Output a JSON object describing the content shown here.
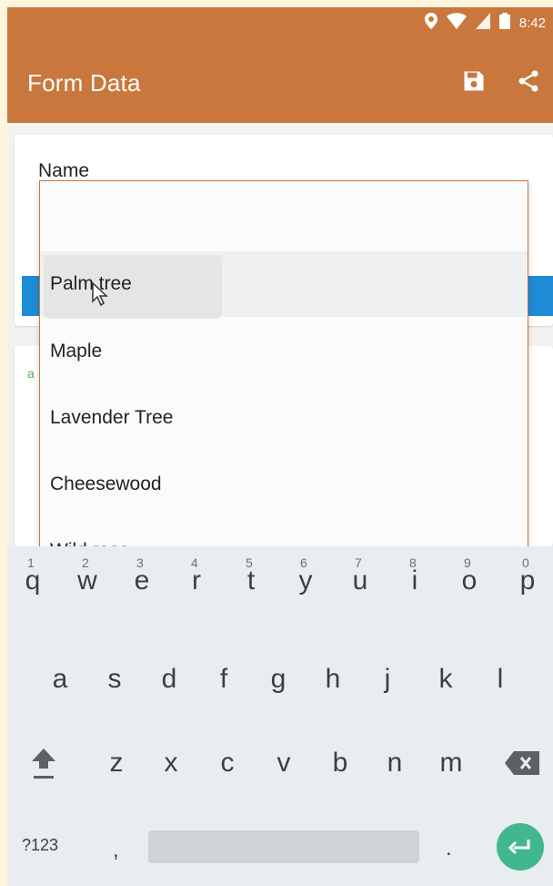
{
  "status_bar": {
    "time": "8:42"
  },
  "app_bar": {
    "title": "Form Data"
  },
  "form": {
    "name_label": "Name"
  },
  "dropdown": {
    "items": [
      {
        "label": "Palm tree",
        "selected": true
      },
      {
        "label": "Maple",
        "selected": false
      },
      {
        "label": "Lavender Tree",
        "selected": false
      },
      {
        "label": "Cheesewood",
        "selected": false
      },
      {
        "label": "Wild rose",
        "selected": false
      }
    ]
  },
  "card2": {
    "hint": "a"
  },
  "keyboard": {
    "row1": [
      {
        "key": "q",
        "num": "1"
      },
      {
        "key": "w",
        "num": "2"
      },
      {
        "key": "e",
        "num": "3"
      },
      {
        "key": "r",
        "num": "4"
      },
      {
        "key": "t",
        "num": "5"
      },
      {
        "key": "y",
        "num": "6"
      },
      {
        "key": "u",
        "num": "7"
      },
      {
        "key": "i",
        "num": "8"
      },
      {
        "key": "o",
        "num": "9"
      },
      {
        "key": "p",
        "num": "0"
      }
    ],
    "row2": [
      "a",
      "s",
      "d",
      "f",
      "g",
      "h",
      "j",
      "k",
      "l"
    ],
    "row3": [
      "z",
      "x",
      "c",
      "v",
      "b",
      "n",
      "m"
    ],
    "symbols_label": "?123",
    "comma": ",",
    "period": "."
  },
  "colors": {
    "accent": "#c9773c",
    "enter": "#42b78f",
    "blue_bar": "#1e8bd6"
  }
}
